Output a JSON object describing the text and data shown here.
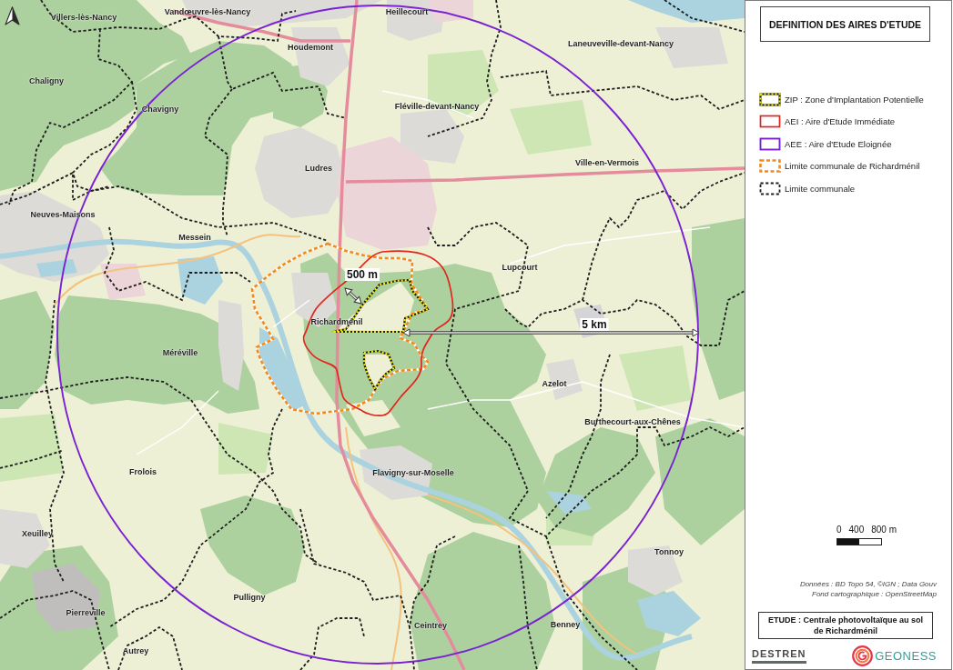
{
  "map": {
    "places": [
      "Villers-lès-Nancy",
      "Vandœuvre-lès-Nancy",
      "Heillecourt",
      "Houdemont",
      "Laneuveville-devant-Nancy",
      "Chaligny",
      "Chavigny",
      "Fléville-devant-Nancy",
      "Ludres",
      "Ville-en-Vermois",
      "Neuves-Maisons",
      "Messein",
      "Lupcourt",
      "Richardménil",
      "Méréville",
      "Azelot",
      "Burthecourt-aux-Chênes",
      "Frolois",
      "Flavigny-sur-Moselle",
      "Xeuilley",
      "Tonnoy",
      "Pulligny",
      "Pierreville",
      "Ceintrey",
      "Benney",
      "Autrey"
    ],
    "measures": [
      {
        "label": "500 m"
      },
      {
        "label": "5 km"
      }
    ]
  },
  "legend": {
    "title": "DEFINITION DES AIRES D'ETUDE",
    "items": [
      {
        "label": "ZIP : Zone d'Implantation Potentielle",
        "kind": "zip"
      },
      {
        "label": "AEI : Aire d'Etude Immédiate",
        "kind": "aei"
      },
      {
        "label": "AEE : Aire d'Etude Eloignée",
        "kind": "aee"
      },
      {
        "label": "Limite communale de Richardménil",
        "kind": "study_town_limit"
      },
      {
        "label": "Limite communale",
        "kind": "town_limit"
      }
    ]
  },
  "scale_bar": {
    "labels": [
      "0",
      "400",
      "800 m"
    ]
  },
  "credits": [
    "Données : BD Topo 54, ©IGN ; Data Gouv",
    "Fond cartographique : OpenStreetMap"
  ],
  "study": {
    "text": "ETUDE : Centrale photovoltaïque au sol de Richardménil"
  },
  "logos": [
    {
      "name": "DESTREN",
      "kind": "destren"
    },
    {
      "name": "GEONESS",
      "kind": "geoness"
    }
  ]
}
